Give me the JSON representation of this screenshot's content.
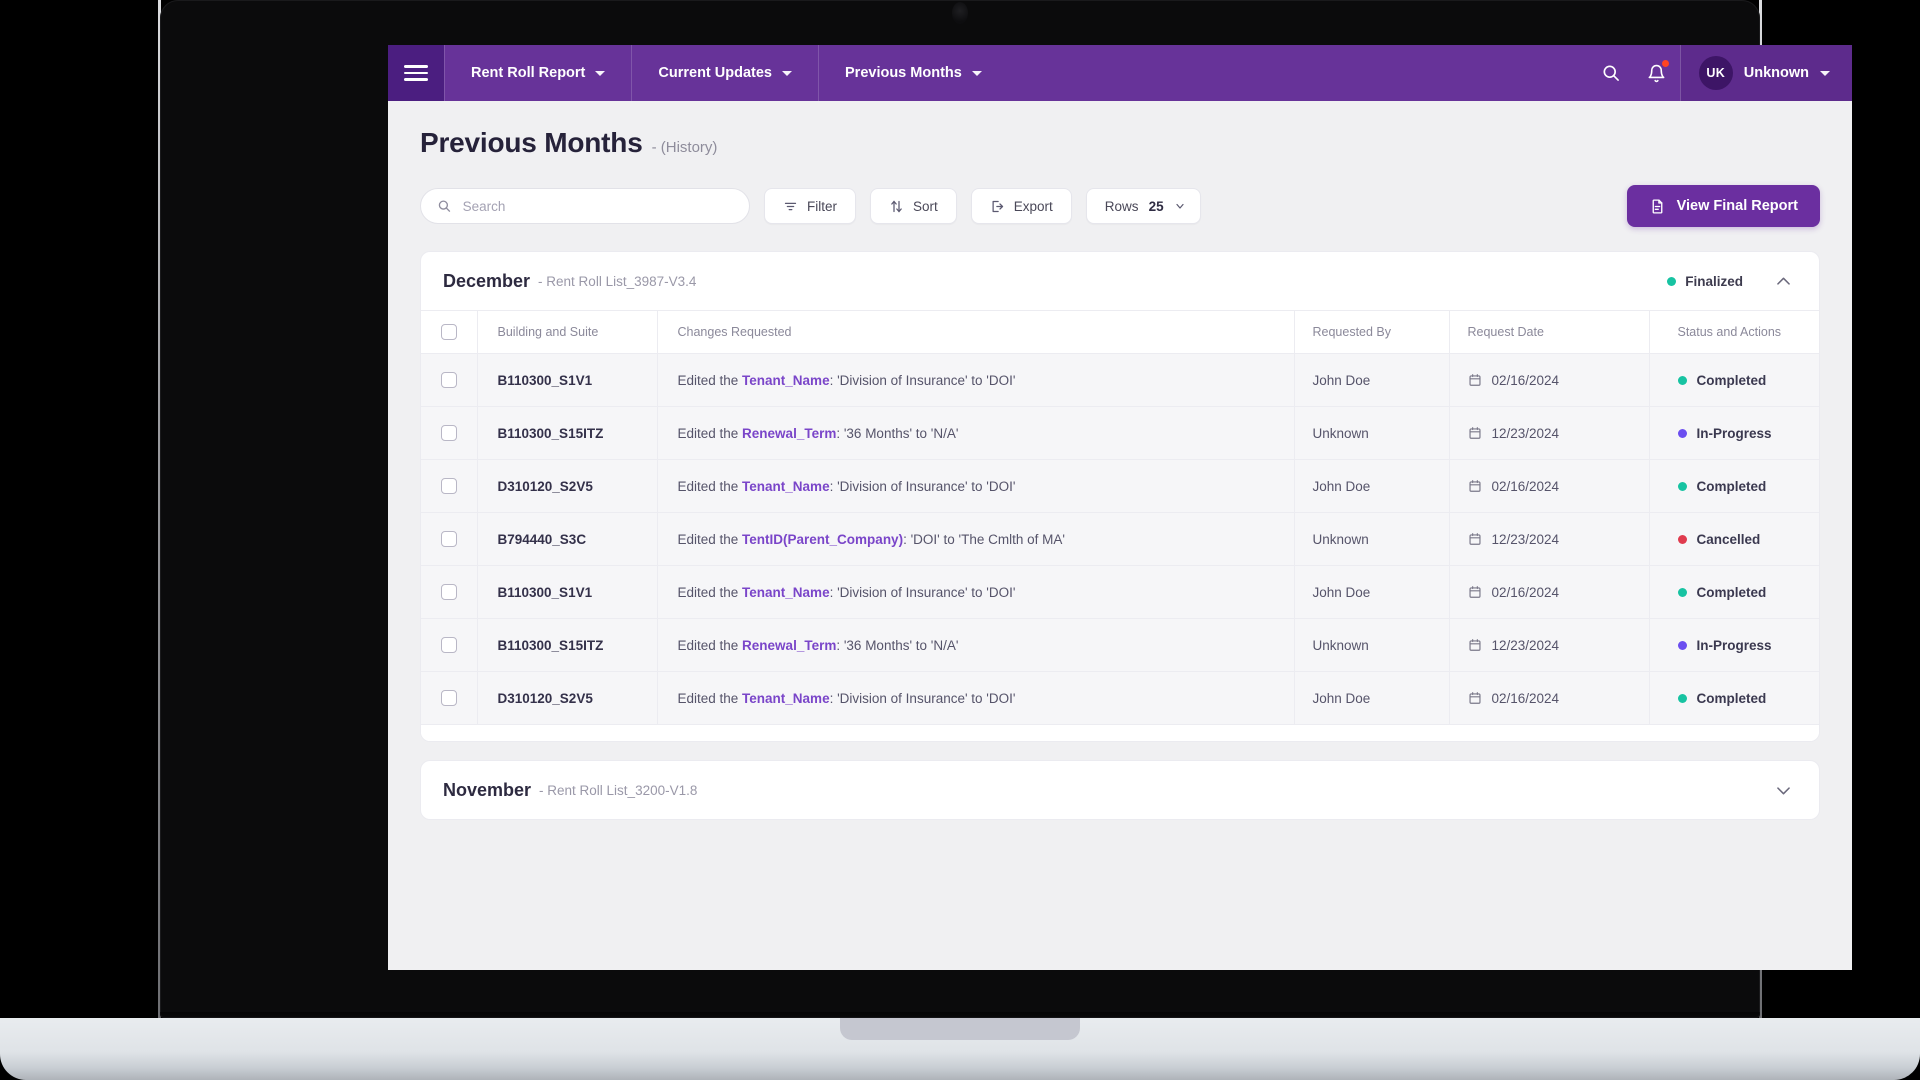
{
  "navbar": {
    "menu_icon": "hamburger-icon",
    "tabs": [
      {
        "label": "Rent Roll Report",
        "has_caret": true
      },
      {
        "label": "Current Updates",
        "has_caret": true
      },
      {
        "label": "Previous Months",
        "has_caret": true
      }
    ],
    "search_icon": "search-icon",
    "bell_icon": "bell-icon",
    "has_notification": true,
    "avatar_initials": "UK",
    "user_name": "Unknown",
    "bar_color": "#673399",
    "menu_block_color": "#4b1e80",
    "notification_dot_color": "#ff4422"
  },
  "page": {
    "title": "Previous Months",
    "subtitle": "- (History)"
  },
  "toolbar": {
    "search_placeholder": "Search",
    "search_value": "",
    "filter_label": "Filter",
    "sort_label": "Sort",
    "export_label": "Export",
    "rows_label": "Rows",
    "rows_value": "25",
    "primary_button_label": "View Final Report",
    "primary_button_color": "#6b2fa0"
  },
  "columns": [
    "Building and Suite",
    "Changes Requested",
    "Requested By",
    "Request Date",
    "Status and Actions"
  ],
  "status_colors": {
    "Completed": "#17c3a2",
    "In-Progress": "#6b4ef0",
    "Cancelled": "#e03b4e",
    "Finalized": "#17c3a2"
  },
  "months": [
    {
      "name": "December",
      "file": "- Rent Roll List_3987-V3.4",
      "status": "Finalized",
      "expanded": true,
      "rows": [
        {
          "building": "B110300_S1V1",
          "change_prefix": "Edited the ",
          "field": "Tenant_Name",
          "change_suffix": ": 'Division of Insurance' to 'DOI'",
          "requested_by": "John Doe",
          "date": "02/16/2024",
          "status": "Completed"
        },
        {
          "building": "B110300_S15ITZ",
          "change_prefix": "Edited the ",
          "field": "Renewal_Term",
          "change_suffix": ": '36 Months' to 'N/A'",
          "requested_by": "Unknown",
          "date": "12/23/2024",
          "status": "In-Progress"
        },
        {
          "building": "D310120_S2V5",
          "change_prefix": "Edited the ",
          "field": "Tenant_Name",
          "change_suffix": ": 'Division of Insurance' to 'DOI'",
          "requested_by": "John Doe",
          "date": "02/16/2024",
          "status": "Completed"
        },
        {
          "building": "B794440_S3C",
          "change_prefix": "Edited the ",
          "field": "TentID(Parent_Company)",
          "change_suffix": ": 'DOI' to 'The Cmlth of MA'",
          "requested_by": "Unknown",
          "date": "12/23/2024",
          "status": "Cancelled"
        },
        {
          "building": "B110300_S1V1",
          "change_prefix": "Edited the ",
          "field": "Tenant_Name",
          "change_suffix": ": 'Division of Insurance' to 'DOI'",
          "requested_by": "John Doe",
          "date": "02/16/2024",
          "status": "Completed"
        },
        {
          "building": "B110300_S15ITZ",
          "change_prefix": "Edited the ",
          "field": "Renewal_Term",
          "change_suffix": ": '36 Months' to 'N/A'",
          "requested_by": "Unknown",
          "date": "12/23/2024",
          "status": "In-Progress"
        },
        {
          "building": "D310120_S2V5",
          "change_prefix": "Edited the ",
          "field": "Tenant_Name",
          "change_suffix": ": 'Division of Insurance' to 'DOI'",
          "requested_by": "John Doe",
          "date": "02/16/2024",
          "status": "Completed"
        }
      ]
    },
    {
      "name": "November",
      "file": "- Rent Roll List_3200-V1.8",
      "status": "",
      "expanded": false,
      "rows": []
    }
  ]
}
